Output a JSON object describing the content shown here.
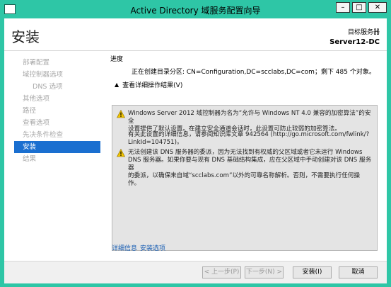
{
  "window": {
    "title": "Active Directory 域服务配置向导"
  },
  "header": {
    "page_title": "安装",
    "target_label": "目标服务器",
    "target_value": "Server12-DC"
  },
  "nav": [
    {
      "label": "部署配置",
      "sub": false,
      "active": false
    },
    {
      "label": "域控制器选项",
      "sub": false,
      "active": false
    },
    {
      "label": "DNS 选项",
      "sub": true,
      "active": false
    },
    {
      "label": "其他选项",
      "sub": false,
      "active": false
    },
    {
      "label": "路径",
      "sub": false,
      "active": false
    },
    {
      "label": "查看选项",
      "sub": false,
      "active": false
    },
    {
      "label": "先决条件检查",
      "sub": false,
      "active": false
    },
    {
      "label": "安装",
      "sub": false,
      "active": true
    },
    {
      "label": "结果",
      "sub": false,
      "active": false
    }
  ],
  "content": {
    "progress_label": "进度",
    "progress_text": "正在创建目录分区: CN=Configuration,DC=scclabs,DC=com；剩下 485 个对象。",
    "details_toggle": "查看详细操作结果(V)",
    "messages": [
      {
        "lines": [
          "Windows Server 2012 域控制器为名为“允许与 Windows NT 4.0 兼容的加密算法”的安全",
          "设置提供了默认设置。在建立安全通道会话时，此设置可防止较弱的加密算法。"
        ]
      },
      {
        "lines": [
          "有关此设置的详细信息，请参阅知识库文章 942564 (http://go.microsoft.com/fwlink/?",
          "LinkId=104751)。"
        ]
      },
      {
        "lines": [
          "无法创建该 DNS 服务器的委派，因为无法找到有权威的父区域或者它未运行 Windows",
          "DNS 服务器。如果你要与现有 DNS 基础结构集成，应在父区域中手动创建对该 DNS 服务器",
          "的委派，以确保来自域“scclabs.com”以外的可靠名称解析。否则，不需要执行任何操",
          "作。"
        ]
      }
    ],
    "links": [
      "详细信息",
      "安装选项"
    ]
  },
  "footer": {
    "prev": "< 上一步(P)",
    "next": "下一步(N) >",
    "install": "安装(I)",
    "cancel": "取消"
  },
  "colors": {
    "accent": "#1a6fd0",
    "titlebar": "#2ec6a6",
    "warning": "#f2c500"
  }
}
